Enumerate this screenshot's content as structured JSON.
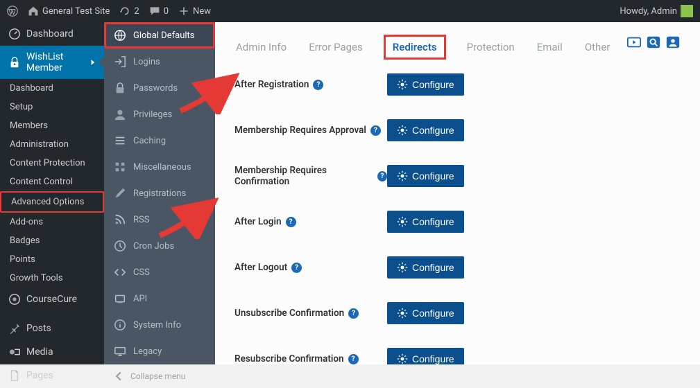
{
  "adminbar": {
    "site_name": "General Test Site",
    "refresh_count": "2",
    "comment_count": "0",
    "new_label": "New",
    "howdy": "Howdy, Admin"
  },
  "adminmenu": {
    "dashboard": "Dashboard",
    "wishlist": "WishList Member",
    "subs": {
      "dashboard": "Dashboard",
      "setup": "Setup",
      "members": "Members",
      "administration": "Administration",
      "content_protection": "Content Protection",
      "content_control": "Content Control",
      "advanced_options": "Advanced Options",
      "addons": "Add-ons",
      "badges": "Badges",
      "points": "Points",
      "growth_tools": "Growth Tools"
    },
    "coursecure": "CourseCure",
    "posts": "Posts",
    "media": "Media",
    "pages": "Pages"
  },
  "submenu2": {
    "global_defaults": "Global Defaults",
    "logins": "Logins",
    "passwords": "Passwords",
    "privileges": "Privileges",
    "caching": "Caching",
    "misc": "Miscellaneous",
    "registrations": "Registrations",
    "rss": "RSS",
    "cron": "Cron Jobs",
    "css": "CSS",
    "api": "API",
    "sysinfo": "System Info",
    "legacy": "Legacy",
    "collapse": "Collapse menu"
  },
  "tabs": {
    "admin_info": "Admin Info",
    "error_pages": "Error Pages",
    "redirects": "Redirects",
    "protection": "Protection",
    "email": "Email",
    "other": "Other"
  },
  "rows": {
    "after_registration": "After Registration",
    "requires_approval": "Membership Requires Approval",
    "requires_confirmation": "Membership Requires Confirmation",
    "after_login": "After Login",
    "after_logout": "After Logout",
    "unsubscribe": "Unsubscribe Confirmation",
    "resubscribe": "Resubscribe Confirmation"
  },
  "buttons": {
    "configure": "Configure"
  }
}
